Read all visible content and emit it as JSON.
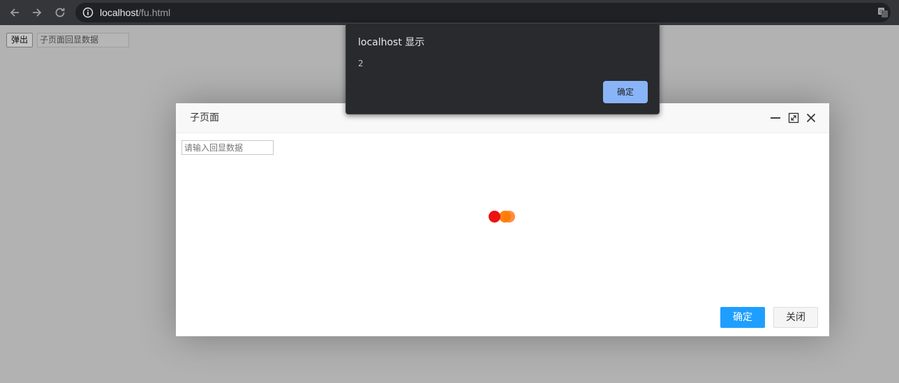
{
  "browser": {
    "url_host": "localhost",
    "url_path": "/fu.html",
    "icons": [
      "back-icon",
      "forward-icon",
      "reload-icon",
      "info-icon",
      "translate-icon"
    ]
  },
  "parent_page": {
    "open_button_label": "弹出",
    "input_value": "子页面回显数据"
  },
  "layer": {
    "title": "子页面",
    "input_placeholder": "请输入回显数据",
    "confirm_label": "确定",
    "close_label": "关闭",
    "accent": "#1e9fff",
    "icons": [
      "minimize-icon",
      "maximize-icon",
      "close-icon"
    ],
    "loading_colors": [
      "#ee1111",
      "#ff7a00"
    ]
  },
  "alert": {
    "title": "localhost 显示",
    "message": "2",
    "ok_label": "确定",
    "accent": "#8ab4f8"
  }
}
